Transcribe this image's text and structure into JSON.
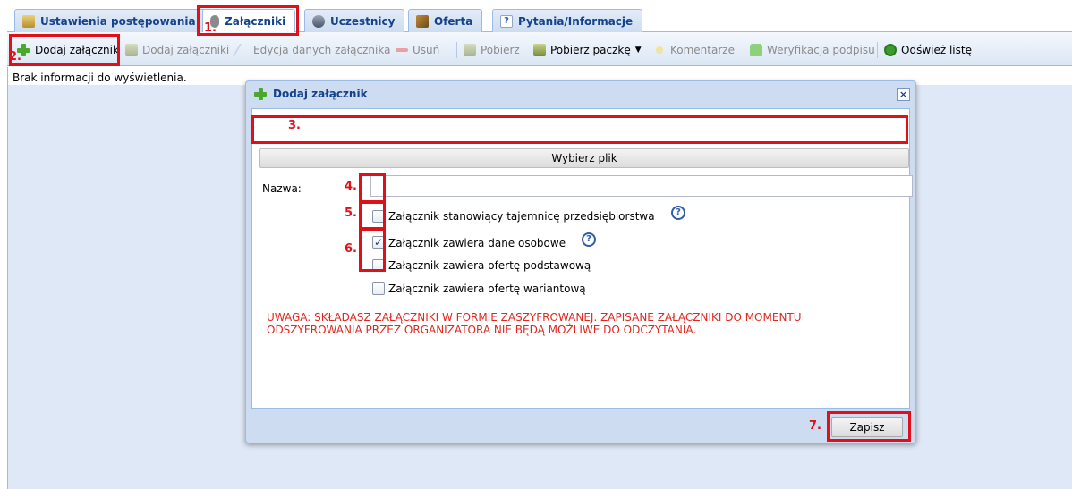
{
  "tabs": [
    {
      "label": "Ustawienia postępowania",
      "icon": "settings-icon"
    },
    {
      "label": "Załączniki",
      "icon": "paperclip-icon",
      "active": true
    },
    {
      "label": "Uczestnicy",
      "icon": "users-icon"
    },
    {
      "label": "Oferta",
      "icon": "gavel-icon"
    },
    {
      "label": "Pytania/Informacje",
      "icon": "question-icon"
    }
  ],
  "toolbar": {
    "add": "Dodaj załącznik",
    "add_many": "Dodaj załączniki",
    "edit": "Edycja danych załącznika",
    "remove": "Usuń",
    "download": "Pobierz",
    "download_pack": "Pobierz paczkę",
    "comments": "Komentarze",
    "verify": "Weryfikacja podpisu",
    "refresh": "Odśwież listę"
  },
  "grid": {
    "empty_text": "Brak informacji do wyświetlenia."
  },
  "dialog": {
    "title": "Dodaj załącznik",
    "close": "×",
    "file_button": "Wybierz plik",
    "name_label": "Nazwa:",
    "name_value": "",
    "checkboxes": [
      {
        "label": "Załącznik stanowiący tajemnicę przedsiębiorstwa",
        "checked": false
      },
      {
        "label": "Załącznik zawiera dane osobowe",
        "checked": true
      },
      {
        "label": "Załącznik zawiera ofertę podstawową",
        "checked": false
      },
      {
        "label": "Załącznik zawiera ofertę wariantową",
        "checked": false
      }
    ],
    "help_glyph": "?",
    "warning": "UWAGA: SKŁADASZ ZAŁĄCZNIKI W FORMIE ZASZYFROWANEJ. ZAPISANE ZAŁĄCZNIKI DO MOMENTU ODSZYFROWANIA PRZEZ ORGANIZATORA NIE BĘDĄ MOŻLIWE DO ODCZYTANIA.",
    "save": "Zapisz"
  },
  "annotations": {
    "n1": "1.",
    "n2": "2.",
    "n3": "3.",
    "n4": "4.",
    "n5": "5.",
    "n6": "6.",
    "n7": "7."
  },
  "colors": {
    "highlight": "#e0101a",
    "warning": "#e0261f",
    "accent": "#15428b"
  }
}
